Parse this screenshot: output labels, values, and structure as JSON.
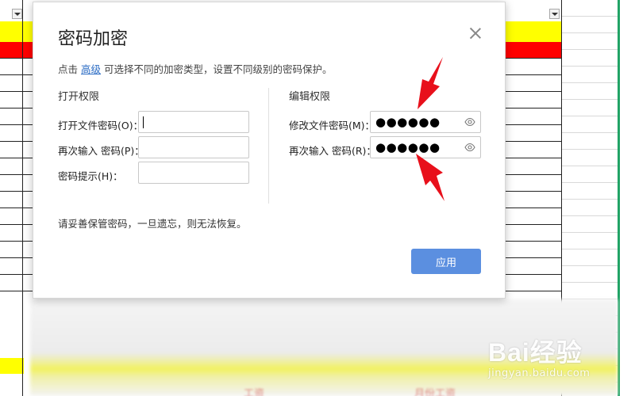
{
  "dialog": {
    "title": "密码加密",
    "description": {
      "prefix": "点击",
      "link": "高级",
      "suffix": "可选择不同的加密类型，设置不同级别的密码保护。"
    },
    "open_permission": {
      "title": "打开权限",
      "file_password_label": "打开文件密码(O)：",
      "file_password_value": "",
      "confirm_password_label": "再次输入 密码(P)：",
      "confirm_password_value": "",
      "hint_label": "密码提示(H)：",
      "hint_value": ""
    },
    "edit_permission": {
      "title": "编辑权限",
      "modify_password_label": "修改文件密码(M)：",
      "modify_password_value": "●●●●●●",
      "confirm_password_label": "再次输入 密码(R)：",
      "confirm_password_value": "●●●●●●"
    },
    "note": "请妥善保管密码，一旦遗忘，则无法恢复。",
    "apply_label": "应用"
  },
  "background": {
    "blurred_text_left": "工资",
    "blurred_text_right": "月份工资"
  },
  "watermark": {
    "logo": "Bai经验",
    "url": "jingyan.baidu.com"
  },
  "colors": {
    "header_yellow": "#ffff00",
    "header_red": "#ff0000",
    "selection_green": "#21a366",
    "apply_blue": "#5b8fe0",
    "link_blue": "#2b6cc4",
    "arrow_red": "#e8101b"
  },
  "icons": {
    "close": "close-icon",
    "eye": "eye-icon",
    "filter": "filter-dropdown-icon"
  }
}
